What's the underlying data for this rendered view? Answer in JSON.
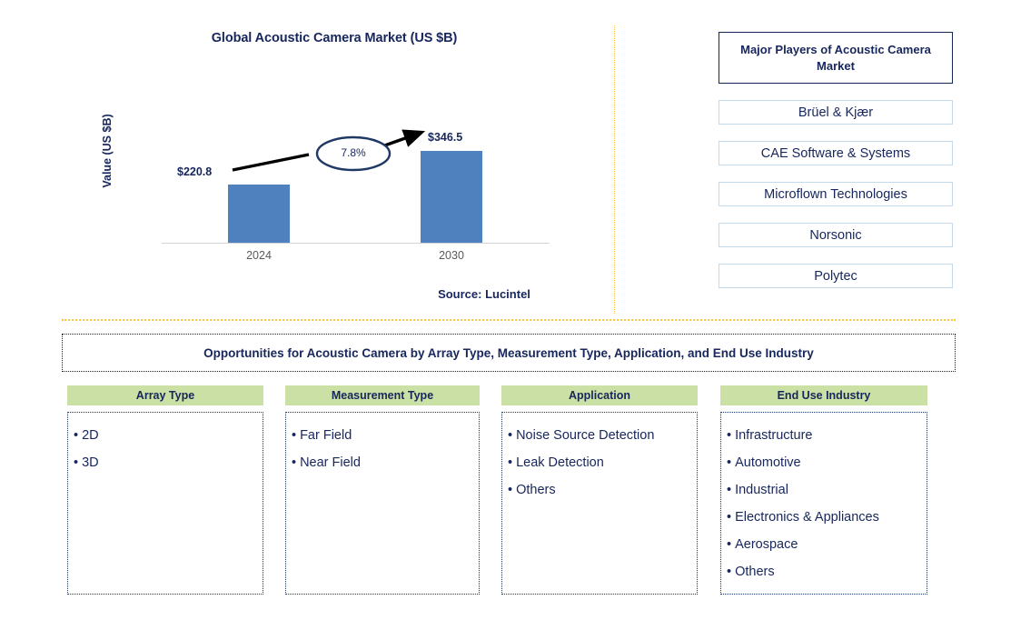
{
  "chart_panel": {
    "title": "Global Acoustic Camera Market (US $B)",
    "y_axis_title": "Value (US $B)",
    "source": "Source: Lucintel"
  },
  "chart_data": {
    "type": "bar",
    "title": "Global Acoustic Camera Market (US $B)",
    "xlabel": "",
    "ylabel": "Value (US $B)",
    "categories": [
      "2024",
      "2030"
    ],
    "values": [
      220.8,
      346.5
    ],
    "value_labels": [
      "$220.8",
      "$346.5"
    ],
    "cagr_label": "7.8%",
    "bar_color": "#4E81BD",
    "ylim": [
      0,
      400
    ],
    "grid": false,
    "legend": "none"
  },
  "players": {
    "header": "Major Players of Acoustic Camera Market",
    "items": [
      "Brüel & Kjær",
      "CAE Software & Systems",
      "Microflown Technologies",
      "Norsonic",
      "Polytec"
    ]
  },
  "opportunities": {
    "banner": "Opportunities for Acoustic Camera by Array Type, Measurement Type, Application, and End Use Industry",
    "columns": [
      {
        "header": "Array Type",
        "items": [
          "2D",
          "3D"
        ]
      },
      {
        "header": "Measurement Type",
        "items": [
          "Far Field",
          "Near Field"
        ]
      },
      {
        "header": "Application",
        "items": [
          "Noise Source Detection",
          "Leak Detection",
          "Others"
        ]
      },
      {
        "header": "End Use Industry",
        "items": [
          "Infrastructure",
          "Automotive",
          "Industrial",
          "Electronics & Appliances",
          "Aerospace",
          "Others"
        ]
      }
    ]
  },
  "colors": {
    "navy_text": "#17265c",
    "bar_blue": "#4E81BD",
    "header_green": "#CBE0A4",
    "divider_amber": "#FFC433",
    "player_border": "#C5D9EC"
  }
}
